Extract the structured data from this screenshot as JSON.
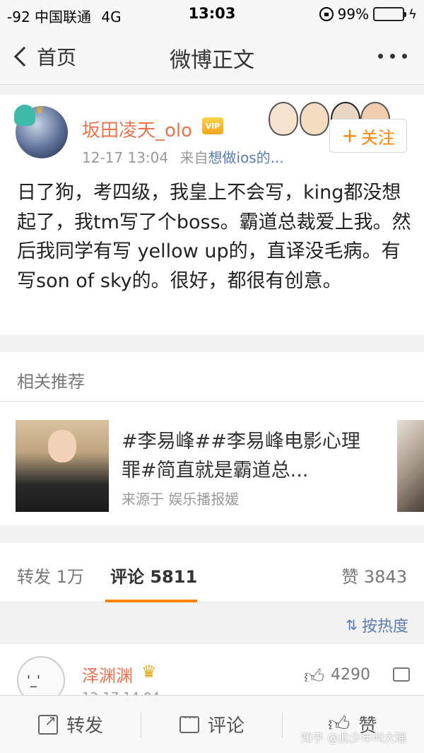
{
  "status_bar": {
    "carrier": "-92 中国联通",
    "network": "4G",
    "time": "13:03",
    "battery": "99%",
    "battery_color": "#4cd964"
  },
  "nav": {
    "back_label": "首页",
    "title": "微博正文",
    "more_icon": "more-dots-icon"
  },
  "post": {
    "username": "坂田凌天_olo",
    "vip_label": "VIP",
    "timestamp": "12-17 13:04",
    "source_prefix": "来自",
    "source": "想做ios的...",
    "follow_label": "关注",
    "text": "日了狗，考四级，我皇上不会写，king都没想起了，我tm写了个boss。霸道总裁爱上我。然后我同学有写 yellow up的，直译没毛病。有写son of sky的。很好，都很有创意。"
  },
  "related": {
    "header": "相关推荐",
    "title": "#李易峰##李易峰电影心理罪#简直就是霸道总...",
    "source": "来源于 娱乐播报媛"
  },
  "tabs": {
    "repost": "转发 1万",
    "comment": "评论 5811",
    "like": "赞 3843"
  },
  "sort": {
    "label": "按热度",
    "icon": "sort-icon"
  },
  "comment": {
    "username": "泽渊渊",
    "badge_icon": "crown-icon",
    "time": "12-17 14:04",
    "likes": "4290"
  },
  "bottom": {
    "repost": "转发",
    "comment": "评论",
    "like": "赞"
  },
  "watermark": "知乎 @此少年叫大瑶",
  "accent_color": "#ff8200",
  "username_color": "#eb7350",
  "link_color": "#5b7cb1"
}
